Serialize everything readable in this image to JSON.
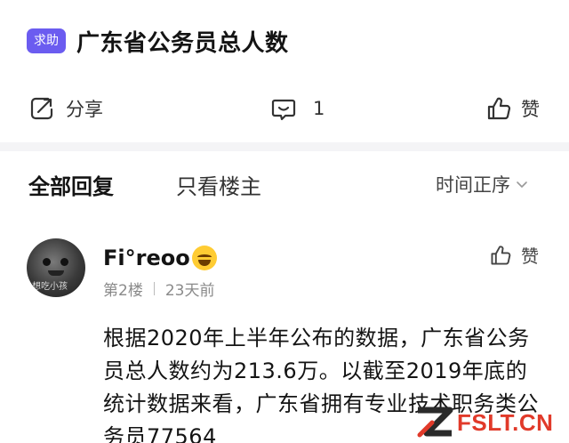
{
  "post": {
    "tag": "求助",
    "title": "广东省公务员总人数"
  },
  "actions": {
    "share_label": "分享",
    "comment_count": "1",
    "like_label": "赞"
  },
  "tabs": {
    "all": "全部回复",
    "owner_only": "只看楼主",
    "sort": "时间正序"
  },
  "reply": {
    "avatar_text": "想吃小孩",
    "username": "Fi°reoo",
    "floor": "第2楼",
    "time": "23天前",
    "like_label": "赞",
    "body": "根据2020年上半年公布的数据，广东省公务员总人数约为213.6万。以截至2019年底的统计数据来看，广东省拥有专业技术职务类公务员77564"
  },
  "watermark": {
    "text": "FSLT.CN"
  },
  "colors": {
    "tag_bg": "#6b5cf0",
    "divider": "#f4f4f6",
    "watermark": "#e13a2a",
    "meta": "#8a8a8a"
  }
}
